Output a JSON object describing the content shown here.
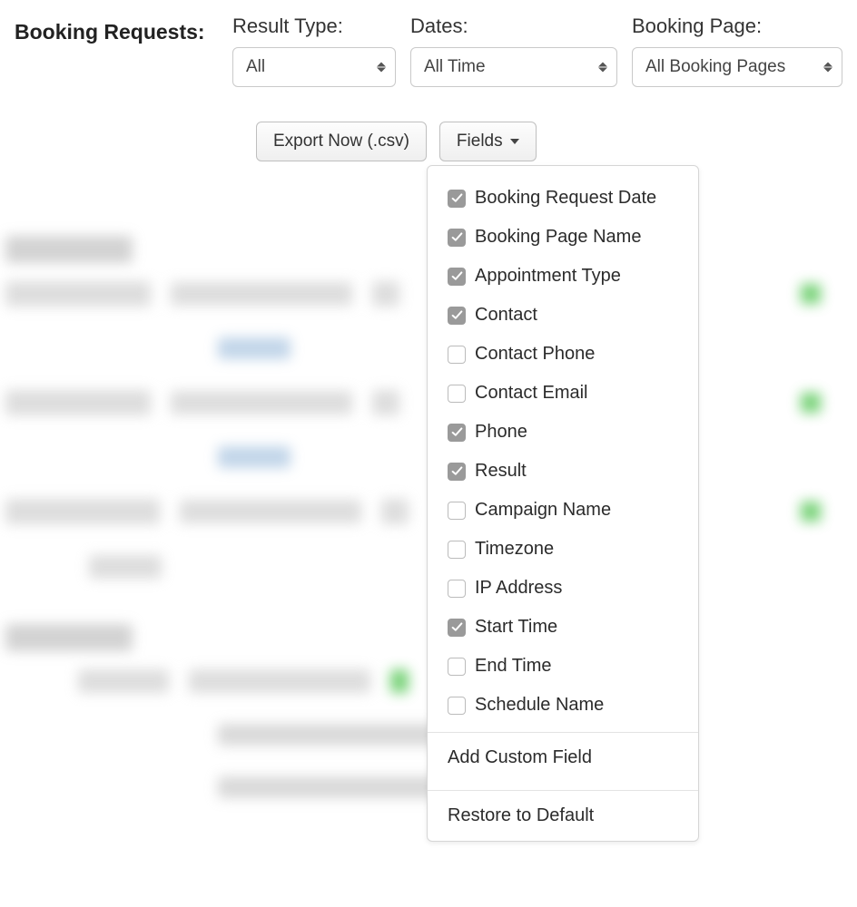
{
  "header": {
    "title": "Booking Requests:"
  },
  "filters": {
    "result_type": {
      "label": "Result Type:",
      "value": "All"
    },
    "dates": {
      "label": "Dates:",
      "value": "All Time"
    },
    "booking_page": {
      "label": "Booking Page:",
      "value": "All Booking Pages"
    }
  },
  "buttons": {
    "export": "Export Now (.csv)",
    "fields": "Fields"
  },
  "fields_dropdown": {
    "items": [
      {
        "label": "Booking Request Date",
        "checked": true
      },
      {
        "label": "Booking Page Name",
        "checked": true
      },
      {
        "label": "Appointment Type",
        "checked": true
      },
      {
        "label": "Contact",
        "checked": true
      },
      {
        "label": "Contact Phone",
        "checked": false
      },
      {
        "label": "Contact Email",
        "checked": false
      },
      {
        "label": "Phone",
        "checked": true
      },
      {
        "label": "Result",
        "checked": true
      },
      {
        "label": "Campaign Name",
        "checked": false
      },
      {
        "label": "Timezone",
        "checked": false
      },
      {
        "label": "IP Address",
        "checked": false
      },
      {
        "label": "Start Time",
        "checked": true
      },
      {
        "label": "End Time",
        "checked": false
      },
      {
        "label": "Schedule Name",
        "checked": false
      }
    ],
    "add_custom": "Add Custom Field",
    "restore": "Restore to Default"
  }
}
